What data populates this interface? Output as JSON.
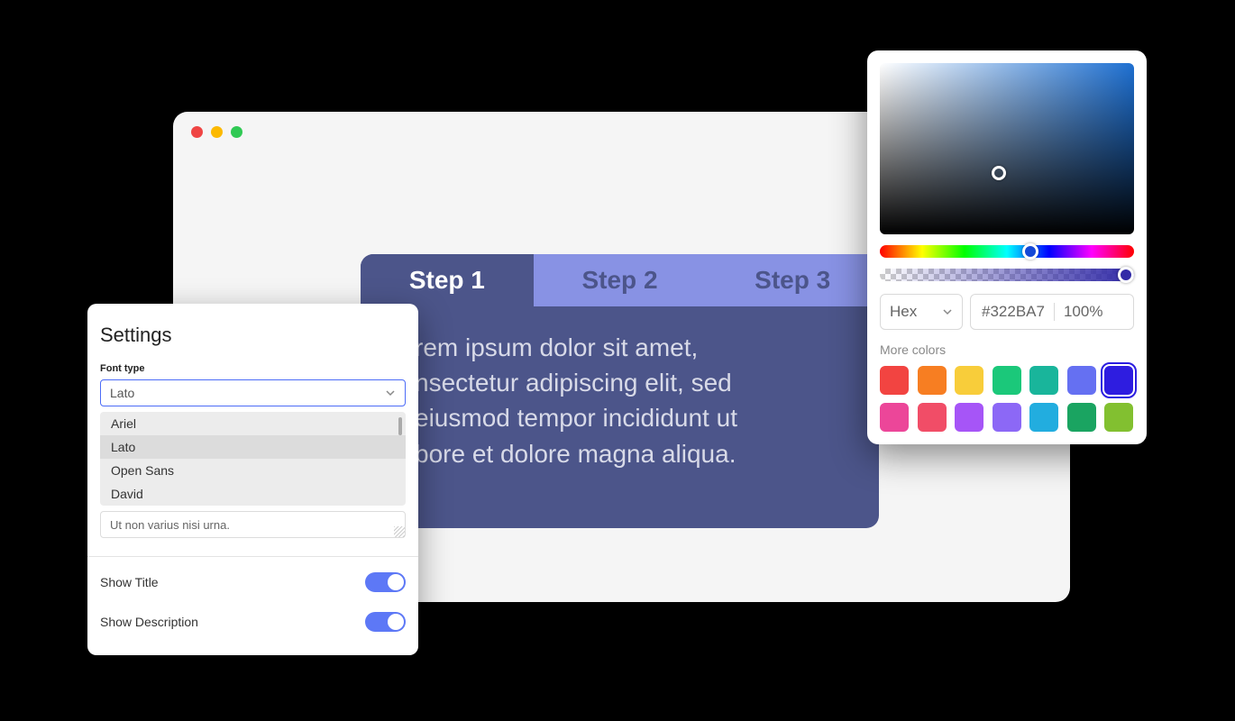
{
  "settings": {
    "title": "Settings",
    "font_type_label": "Font type",
    "font_selected": "Lato",
    "font_options": [
      "Ariel",
      "Lato",
      "Open Sans",
      "David"
    ],
    "text_value": "Ut non varius nisi urna.",
    "show_title_label": "Show Title",
    "show_description_label": "Show Description",
    "show_title_on": true,
    "show_description_on": true
  },
  "steps": {
    "tabs": [
      "Step 1",
      "Step 2",
      "Step 3"
    ],
    "active_index": 0,
    "body": "rem ipsum dolor sit amet,\nnsectetur adipiscing elit, sed\neiusmod tempor incididunt ut\nbore et dolore magna aliqua."
  },
  "colorpicker": {
    "format": "Hex",
    "hex": "#322BA7",
    "alpha": "100%",
    "more_colors_label": "More colors",
    "swatches": [
      "#f24441",
      "#f77e22",
      "#f8cd3a",
      "#1bc87a",
      "#19b59b",
      "#6570f2",
      "#2e1de0",
      "#ec4699",
      "#f14d67",
      "#a655f7",
      "#8c68f6",
      "#22addf",
      "#1aa461",
      "#82c030"
    ],
    "selected_swatch_index": 6
  }
}
